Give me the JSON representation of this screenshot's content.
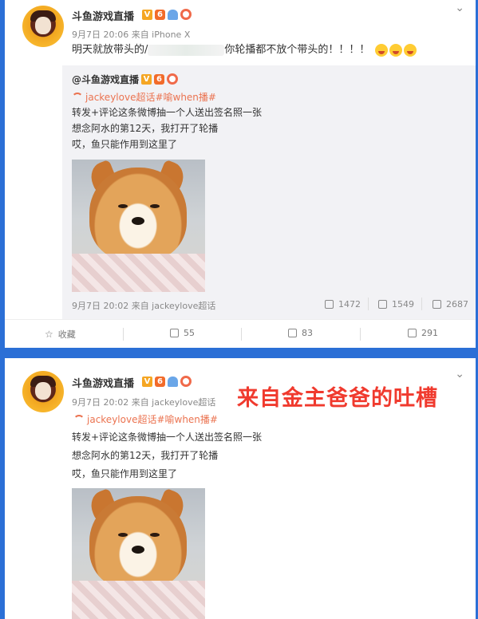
{
  "post1": {
    "author": "斗鱼游戏直播",
    "meta": "9月7日 20:06 来自 iPhone X",
    "text_before": "明天就放带头的/",
    "text_after": "你轮播都不放个带头的！！！！",
    "repost": {
      "author": "@斗鱼游戏直播",
      "topic": "jackeylove超话#喻when播#",
      "lines": [
        "转发+评论这条微博抽一个人送出签名照一张",
        "想念阿水的第12天，我打开了轮播",
        "哎，鱼只能作用到这里了"
      ],
      "meta": "9月7日 20:02 来自 jackeylove超话",
      "reposts": "1472",
      "comments": "1549",
      "likes": "2687"
    },
    "actions": {
      "favorite": "收藏",
      "repost": "55",
      "comment": "83",
      "like": "291"
    }
  },
  "post2": {
    "author": "斗鱼游戏直播",
    "meta": "9月7日 20:02 来自 jackeylove超话",
    "topic": "jackeylove超话#喻when播#",
    "lines": [
      "转发+评论这条微博抽一个人送出签名照一张",
      "想念阿水的第12天，我打开了轮播",
      "哎，鱼只能作用到这里了"
    ]
  },
  "annotation": "来自金主爸爸的吐槽",
  "colors": {
    "background": "#2b6fd6",
    "topic": "#eb7350",
    "annotation": "#f03a2e"
  },
  "icons": [
    "chevron-down-icon",
    "vip-v-icon",
    "level-icon",
    "user-icon",
    "ring-icon",
    "topic-icon",
    "repost-icon",
    "comment-icon",
    "like-icon",
    "crying-emoji-icon"
  ]
}
